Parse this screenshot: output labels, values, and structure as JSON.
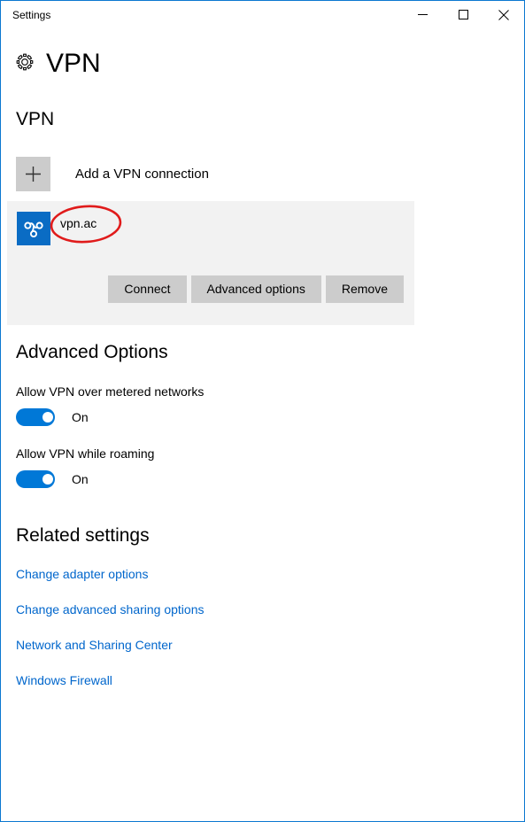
{
  "window": {
    "titlebar_text": "Settings",
    "controls": [
      {
        "name": "minimize",
        "glyph": "minimize-icon"
      },
      {
        "name": "maximize",
        "glyph": "maximize-icon"
      },
      {
        "name": "close",
        "glyph": "close-icon"
      }
    ],
    "border_color": "#0b78d0"
  },
  "header": {
    "icon": "gear-icon",
    "title": "VPN"
  },
  "vpn_section": {
    "heading": "VPN",
    "add_connection": {
      "icon": "plus-icon",
      "label": "Add a VPN connection"
    },
    "connection": {
      "icon": "vpn-provider-icon",
      "icon_background": "#0a6cc4",
      "name": "vpn.ac",
      "panel_background": "#f2f2f2",
      "buttons": [
        {
          "label": "Connect",
          "name": "connect"
        },
        {
          "label": "Advanced options",
          "name": "advanced-options"
        },
        {
          "label": "Remove",
          "name": "remove"
        }
      ],
      "button_color": "#cccccc"
    }
  },
  "advanced_options": {
    "heading": "Advanced Options",
    "settings": [
      {
        "label": "Allow VPN over metered networks",
        "state": "On",
        "on": true
      },
      {
        "label": "Allow VPN while roaming",
        "state": "On",
        "on": true
      }
    ],
    "toggle_on_color": "#0078d7"
  },
  "related_settings": {
    "heading": "Related settings",
    "links": [
      "Change adapter options",
      "Change advanced sharing options",
      "Network and Sharing Center",
      "Windows Firewall"
    ],
    "link_color": "#0066cc"
  },
  "annotation": {
    "type": "ellipse",
    "color": "#e01b1b",
    "target": "vpn.ac"
  }
}
